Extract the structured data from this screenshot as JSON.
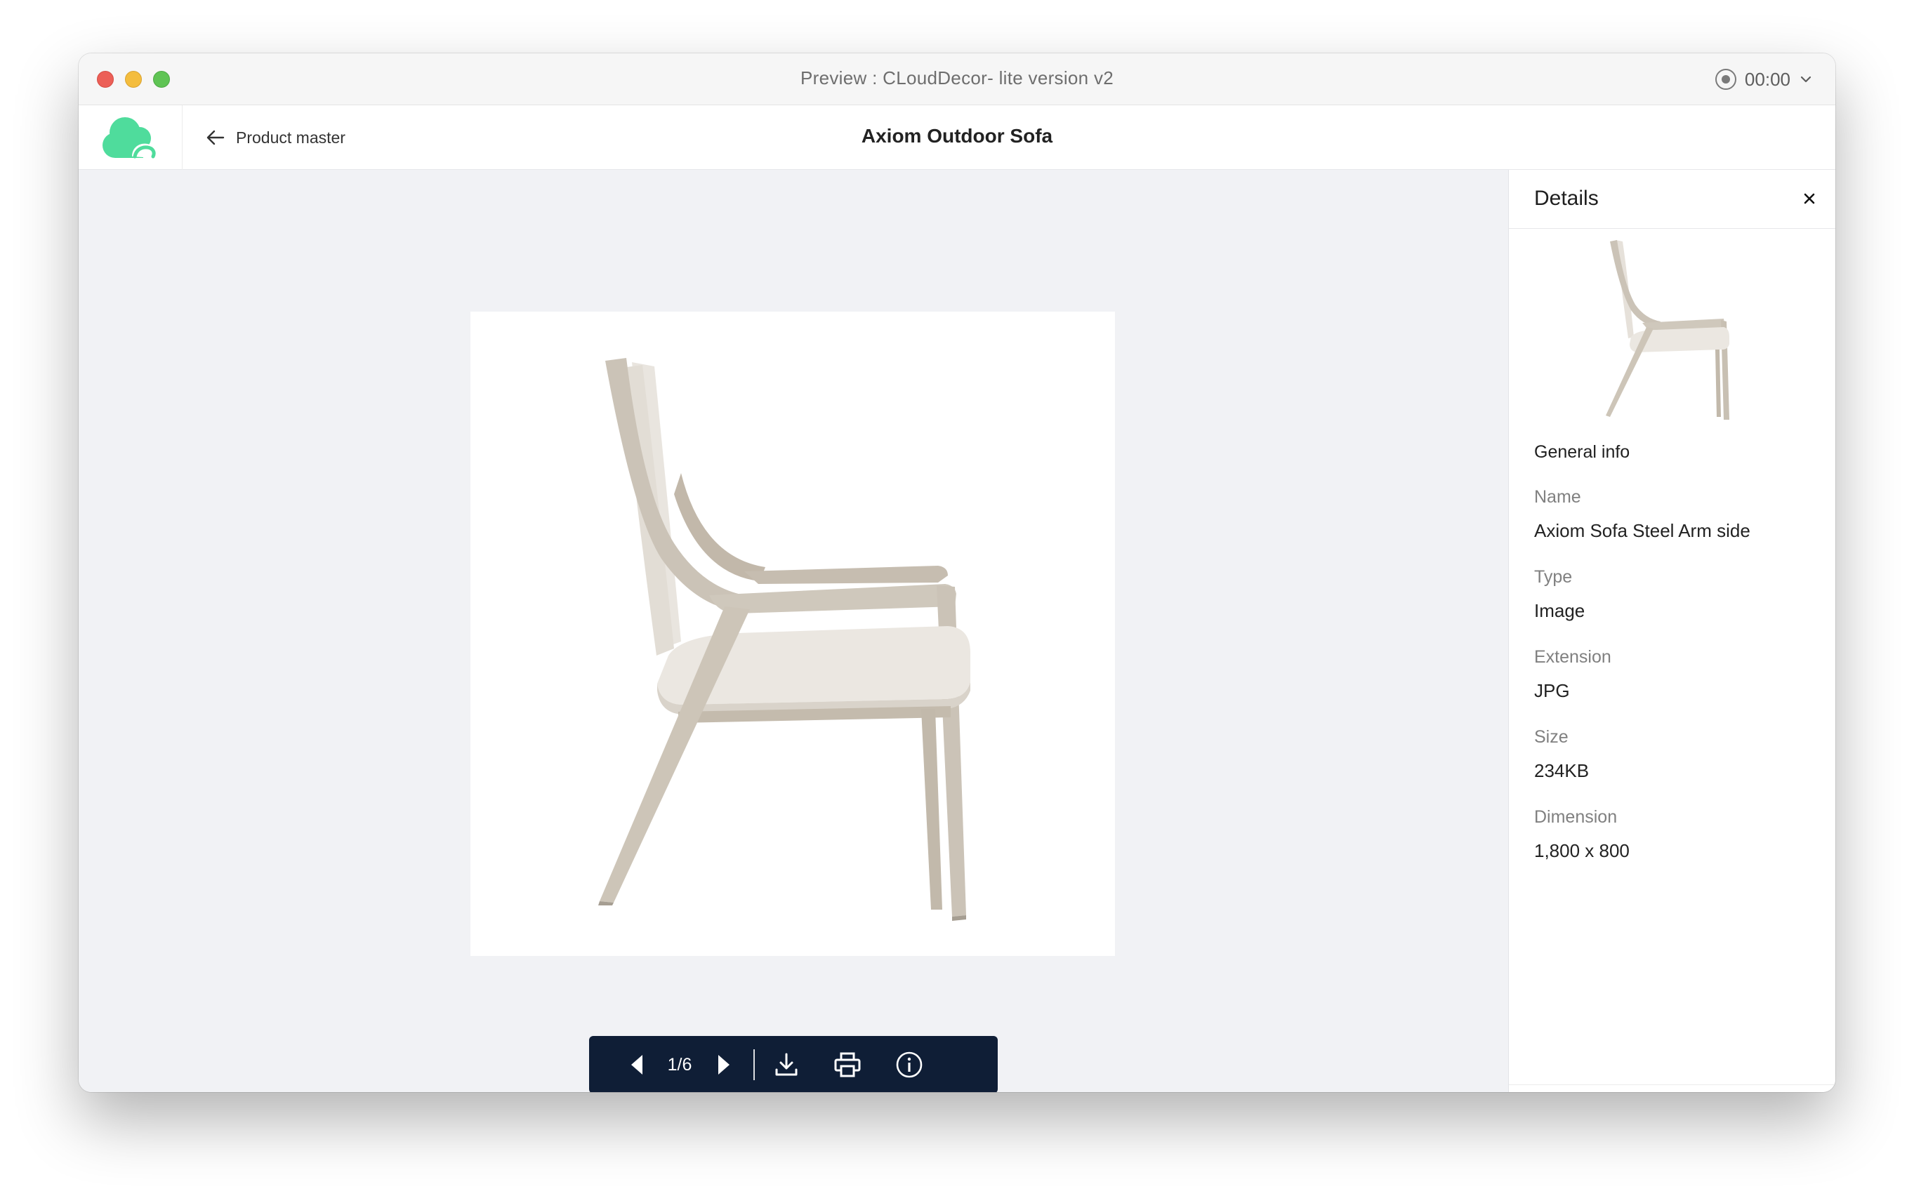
{
  "window": {
    "title": "Preview : CLoudDecor- lite version v2",
    "recorder_time": "00:00"
  },
  "header": {
    "back_label": "Product master",
    "title": "Axiom Outdoor Sofa"
  },
  "viewer": {
    "page_counter": "1/6",
    "icons": [
      "prev-icon",
      "next-icon",
      "download-icon",
      "print-icon",
      "info-icon"
    ]
  },
  "details": {
    "title": "Details",
    "section_title": "General info",
    "fields": [
      {
        "label": "Name",
        "value": "Axiom Sofa Steel Arm side"
      },
      {
        "label": "Type",
        "value": "Image"
      },
      {
        "label": "Extension",
        "value": "JPG"
      },
      {
        "label": "Size",
        "value": "234KB"
      },
      {
        "label": "Dimension",
        "value": "1,800 x 800"
      }
    ]
  },
  "colors": {
    "logo_green": "#4fdc9c",
    "toolbar_bg": "#0f1e36",
    "viewer_bg": "#f1f2f5",
    "chair_wood": "#cbc3b7",
    "chair_fabric": "#e9e5df"
  }
}
